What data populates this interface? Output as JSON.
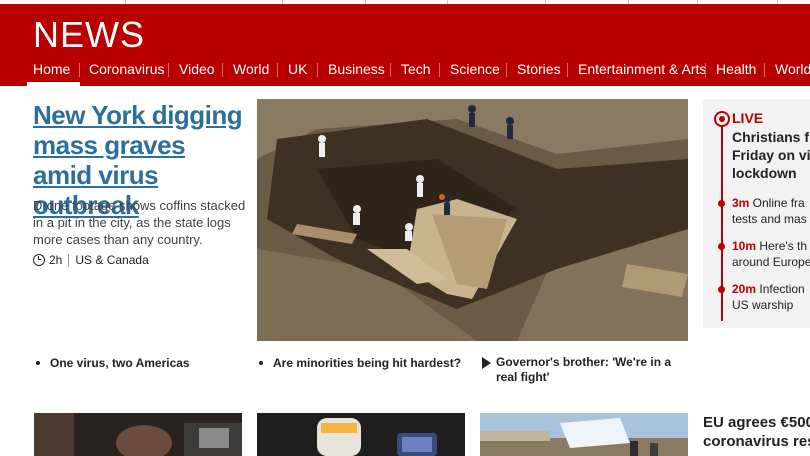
{
  "header": {
    "logo": "NEWS",
    "nav": [
      {
        "label": "Home"
      },
      {
        "label": "Coronavirus"
      },
      {
        "label": "Video"
      },
      {
        "label": "World"
      },
      {
        "label": "UK"
      },
      {
        "label": "Business"
      },
      {
        "label": "Tech"
      },
      {
        "label": "Science"
      },
      {
        "label": "Stories"
      },
      {
        "label": "Entertainment & Arts"
      },
      {
        "label": "Health"
      },
      {
        "label": "World"
      }
    ],
    "active_tab": "Home",
    "brand_color": "#b80000"
  },
  "lead": {
    "title": "New York digging mass graves amid virus outbreak",
    "summary": "Drone footage shows coffins stacked in a pit in the city, as the state logs more cases than any country.",
    "time": "2h",
    "section": "US & Canada",
    "link_color": "#2d6f9c"
  },
  "related": [
    {
      "label": "One virus, two Americas",
      "icon": "bullet"
    },
    {
      "label": "Are minorities being hit hardest?",
      "icon": "bullet"
    },
    {
      "label": "Governor's brother: 'We're in a real fight'",
      "icon": "play-icon"
    }
  ],
  "live": {
    "label": "LIVE",
    "title_lines": [
      "Christians f",
      "Friday on vi",
      "lockdown"
    ],
    "entries": [
      {
        "time": "3m",
        "line1": " Online fra",
        "line2": "tests and mas"
      },
      {
        "time": "10m",
        "line1": " Here's th",
        "line2": "around Europe"
      },
      {
        "time": "20m",
        "line1": " Infection",
        "line2": "US warship"
      }
    ]
  },
  "second_row": {
    "eu_title_lines": [
      "EU agrees €500",
      "coronavirus res"
    ]
  }
}
